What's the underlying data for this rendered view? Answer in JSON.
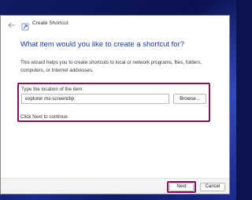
{
  "window": {
    "title": "Create Shortcut",
    "back_icon": "arrow-left-icon",
    "app_icon": "shortcut-icon"
  },
  "main": {
    "heading": "What item would you like to create a shortcut for?",
    "description": "This wizard helps you to create shortcuts to local or network programs, files, folders, computers, or Internet addresses.",
    "location_label": "Type the location of the item:",
    "location_value": "explorer ms-screenclip:",
    "browse_label": "Browse...",
    "hint": "Click Next to continue."
  },
  "footer": {
    "next_label": "Next",
    "cancel_label": "Cancel"
  },
  "colors": {
    "accent": "#1a3a9a",
    "highlight": "#7a1660"
  }
}
